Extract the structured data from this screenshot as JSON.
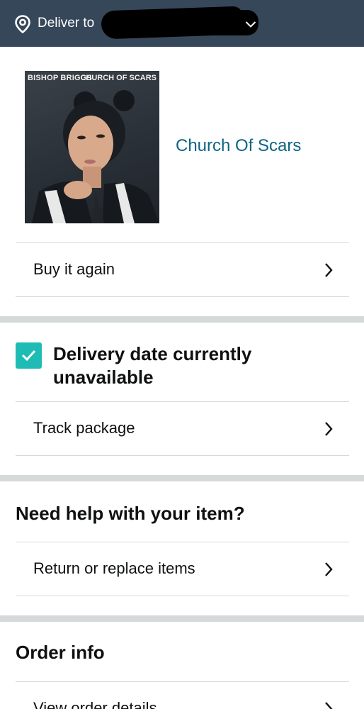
{
  "header": {
    "deliver_label": "Deliver to",
    "address_redacted": "",
    "background_color": "#37475a"
  },
  "product": {
    "album_artist_text": "BISHOP BRIGGS",
    "album_title_text": "CHURCH OF SCARS",
    "title": "Church Of Scars",
    "link_color": "#0e6484"
  },
  "actions": {
    "buy_again": "Buy it again",
    "track_package": "Track package",
    "return_replace": "Return or replace items",
    "view_order_details": "View order details"
  },
  "delivery": {
    "status": "Delivery date currently unavailable",
    "check_color": "#1fbcb5"
  },
  "help": {
    "heading": "Need help with your item?"
  },
  "order": {
    "heading": "Order info"
  },
  "icons": {
    "location": "location-pin-icon",
    "chevron_down": "chevron-down-icon",
    "chevron_right": "chevron-right-icon",
    "check": "check-icon"
  }
}
